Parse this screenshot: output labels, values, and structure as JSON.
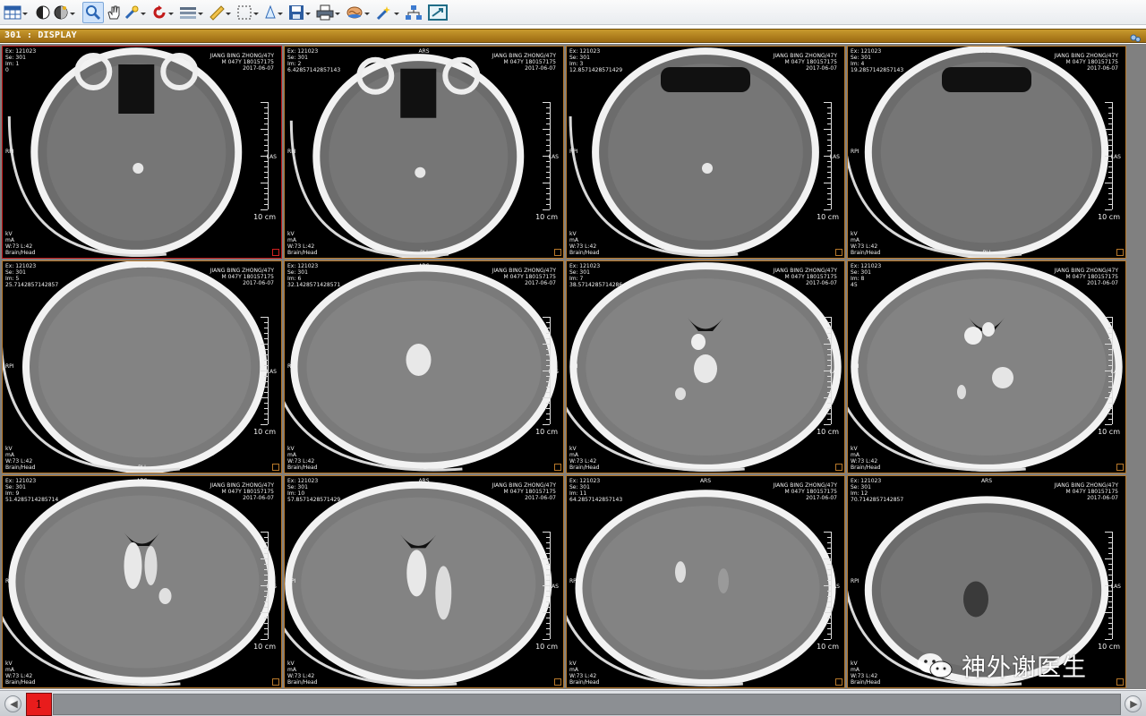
{
  "toolbar": {
    "items": [
      {
        "name": "layout-grid-icon",
        "dropdown": true
      },
      {
        "name": "window-level-icon",
        "dropdown": false
      },
      {
        "name": "preset-icon",
        "dropdown": true
      },
      {
        "name": "zoom-icon",
        "dropdown": false,
        "active": true
      },
      {
        "name": "pan-hand-icon",
        "dropdown": false
      },
      {
        "name": "pointer-icon",
        "dropdown": true
      },
      {
        "name": "rotate-icon",
        "dropdown": true
      },
      {
        "name": "stack-icon",
        "dropdown": true
      },
      {
        "name": "ruler-icon",
        "dropdown": true
      },
      {
        "name": "roi-select-icon",
        "dropdown": true
      },
      {
        "name": "annotation-icon",
        "dropdown": true
      },
      {
        "name": "save-icon",
        "dropdown": true
      },
      {
        "name": "print-icon",
        "dropdown": true
      },
      {
        "name": "3d-brain-icon",
        "dropdown": true
      },
      {
        "name": "tools-icon",
        "dropdown": true
      },
      {
        "name": "network-icon",
        "dropdown": false
      },
      {
        "name": "fit-window-icon",
        "dropdown": false
      }
    ]
  },
  "window": {
    "title": "301 : DISPLAY",
    "config_icon": "settings-icon"
  },
  "overlay": {
    "exam": "Ex: 121023",
    "series": "Se: 301",
    "patient_name": "JIANG BING ZHONG/47Y",
    "patient_info": "M 047Y 180157175",
    "date": "2017-06-07",
    "orient_top": "ARS",
    "orient_bottom": "PLI",
    "orient_left": "RPI",
    "orient_right": "LAS",
    "kv": "kV",
    "ma": "mA",
    "window": "W:73 L:42",
    "protocol": "Brain/Head",
    "scale": "10 cm"
  },
  "images": [
    {
      "im": "Im: 1",
      "pos": "0"
    },
    {
      "im": "Im: 2",
      "pos": "6.42857142857143"
    },
    {
      "im": "Im: 3",
      "pos": "12.8571428571429"
    },
    {
      "im": "Im: 4",
      "pos": "19.2857142857143"
    },
    {
      "im": "Im: 5",
      "pos": "25.7142857142857"
    },
    {
      "im": "Im: 6",
      "pos": "32.1428571428571"
    },
    {
      "im": "Im: 7",
      "pos": "38.5714285714286"
    },
    {
      "im": "Im: 8",
      "pos": "45"
    },
    {
      "im": "Im: 9",
      "pos": "51.4285714285714"
    },
    {
      "im": "Im: 10",
      "pos": "57.8571428571429"
    },
    {
      "im": "Im: 11",
      "pos": "64.2857142857143"
    },
    {
      "im": "Im: 12",
      "pos": "70.7142857142857"
    }
  ],
  "pager": {
    "page": "1",
    "prev_icon": "arrow-left-icon",
    "next_icon": "arrow-right-icon"
  },
  "watermark": {
    "text": "神外谢医生",
    "icon": "wechat-icon"
  }
}
